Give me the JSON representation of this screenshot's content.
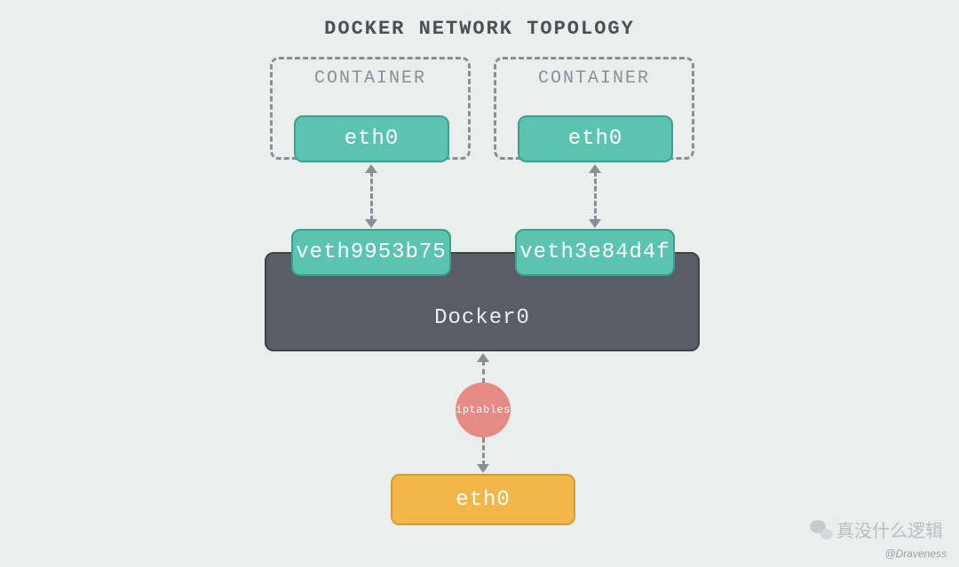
{
  "title": "DOCKER NETWORK TOPOLOGY",
  "containers": {
    "left": {
      "label": "CONTAINER",
      "eth": "eth0"
    },
    "right": {
      "label": "CONTAINER",
      "eth": "eth0"
    }
  },
  "veth": {
    "left": "veth9953b75",
    "right": "veth3e84d4f"
  },
  "bridge": "Docker0",
  "iptables": "iptables",
  "host_eth": "eth0",
  "watermark_cn": "真没什么逻辑",
  "watermark_en": "@Draveness"
}
